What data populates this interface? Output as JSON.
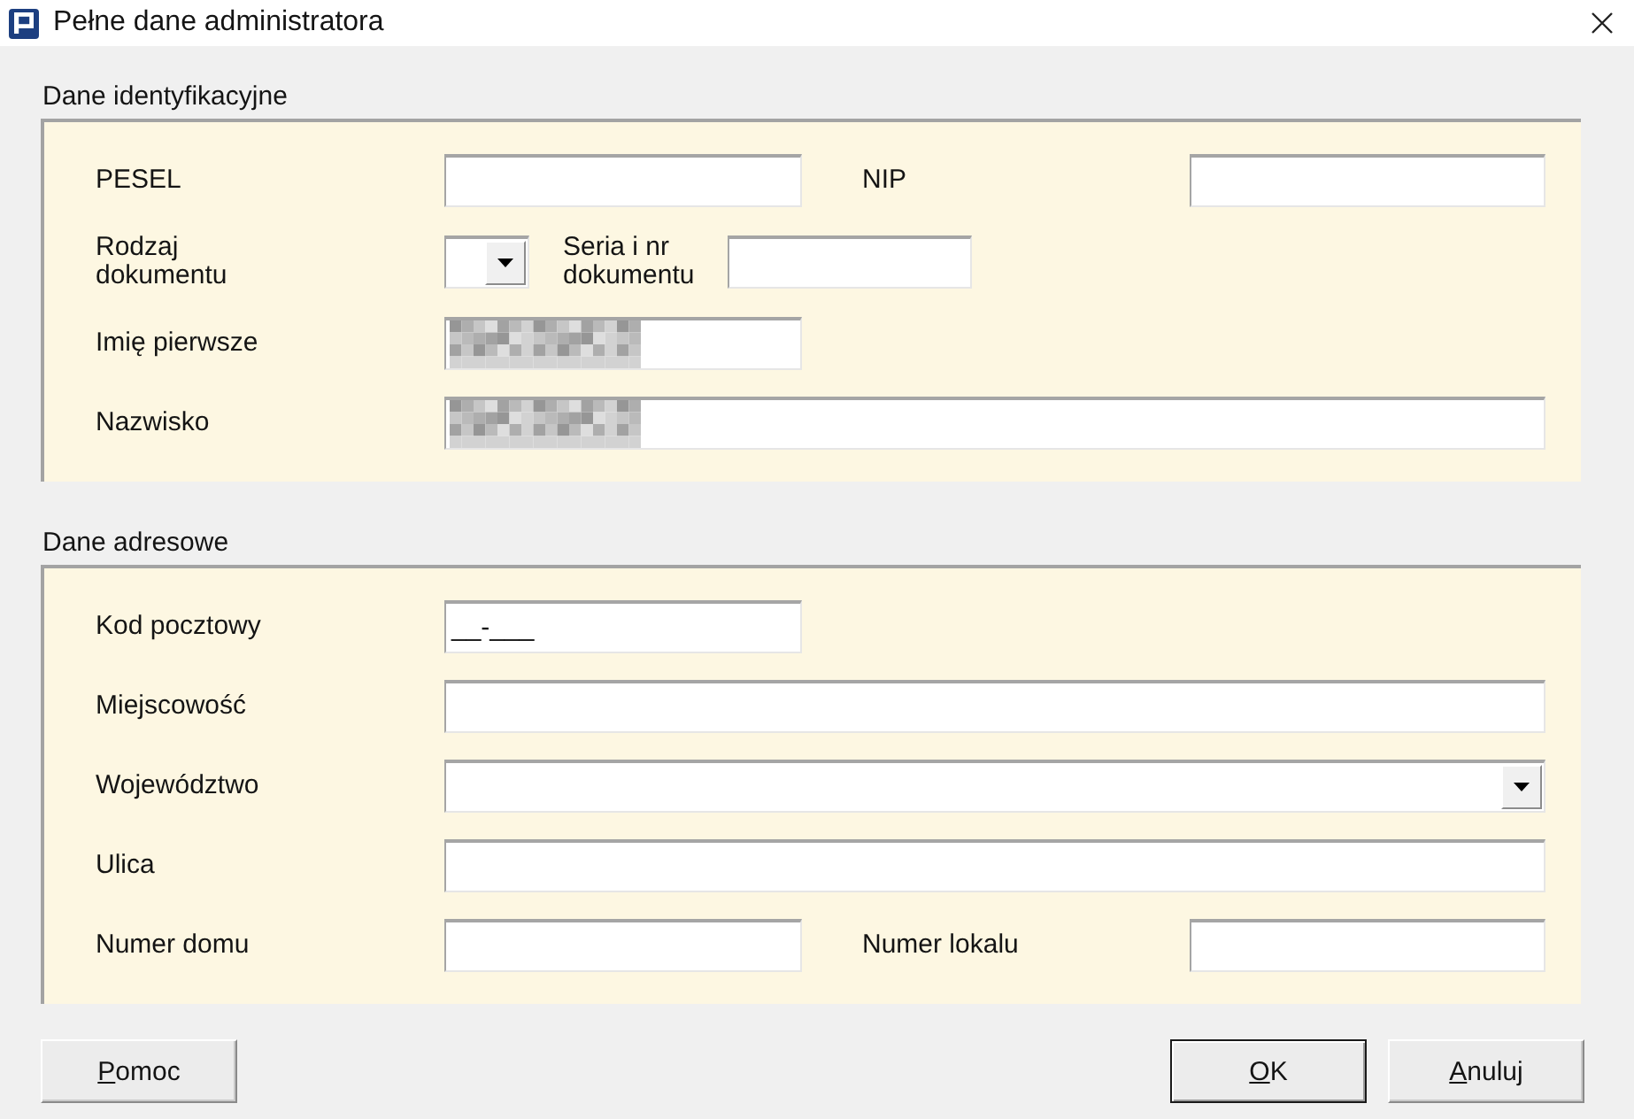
{
  "window": {
    "title": "Pełne dane administratora"
  },
  "sections": [
    {
      "title": "Dane identyfikacyjne",
      "rows": [
        {
          "kind": "pair",
          "items": [
            {
              "label": "PESEL",
              "field": {
                "kind": "text",
                "redacted": false
              }
            },
            {
              "label": "NIP",
              "field": {
                "kind": "text",
                "redacted": false
              }
            }
          ]
        },
        {
          "kind": "inline",
          "items": [
            {
              "label": "Rodzaj dokumentu",
              "field": {
                "kind": "dropdown",
                "redacted": false
              }
            },
            {
              "label": "Seria i nr dokumentu",
              "field": {
                "kind": "text",
                "redacted": false
              }
            }
          ]
        },
        {
          "kind": "short",
          "items": [
            {
              "label": "Imię pierwsze",
              "field": {
                "kind": "text",
                "redacted": true
              }
            }
          ]
        },
        {
          "kind": "wide",
          "items": [
            {
              "label": "Nazwisko",
              "field": {
                "kind": "text",
                "redacted": true
              }
            }
          ]
        }
      ]
    },
    {
      "title": "Dane adresowe",
      "rows": [
        {
          "kind": "short",
          "items": [
            {
              "label": "Kod pocztowy",
              "field": {
                "kind": "text",
                "value": "__-___",
                "redacted": false
              }
            }
          ]
        },
        {
          "kind": "wide",
          "items": [
            {
              "label": "Miejscowość",
              "field": {
                "kind": "text",
                "redacted": false
              }
            }
          ]
        },
        {
          "kind": "wide",
          "items": [
            {
              "label": "Województwo",
              "field": {
                "kind": "dropdown",
                "redacted": false
              }
            }
          ]
        },
        {
          "kind": "wide",
          "items": [
            {
              "label": "Ulica",
              "field": {
                "kind": "text",
                "redacted": false
              }
            }
          ]
        },
        {
          "kind": "pair",
          "items": [
            {
              "label": "Numer domu",
              "field": {
                "kind": "text",
                "redacted": false
              }
            },
            {
              "label": "Numer lokalu",
              "field": {
                "kind": "text",
                "redacted": false
              }
            }
          ]
        }
      ]
    }
  ],
  "buttons": {
    "left": [
      {
        "access_key": "P",
        "label_rest": "omoc",
        "default": false
      }
    ],
    "right": [
      {
        "access_key": "O",
        "label_rest": "K",
        "default": true
      },
      {
        "access_key": "A",
        "label_rest": "nuluj",
        "default": false
      }
    ]
  }
}
